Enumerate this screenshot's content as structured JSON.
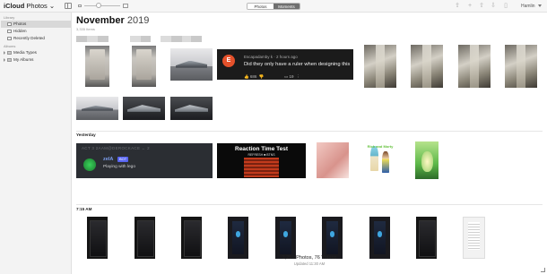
{
  "app": {
    "title_bold": "iCloud",
    "title_rest": " Photos",
    "title_caret": "⌄"
  },
  "toolbar": {
    "segment": [
      {
        "label": "Photos",
        "active": false
      },
      {
        "label": "Moments",
        "active": true
      }
    ],
    "user_name": "Hamlin",
    "zoom_level": 0.4
  },
  "sidebar": {
    "library_heading": "Library",
    "library_items": [
      {
        "label": "Photos",
        "active": true
      },
      {
        "label": "Hidden"
      },
      {
        "label": "Recently Deleted"
      }
    ],
    "albums_heading": "Albums",
    "album_items": [
      {
        "label": "Media Types"
      },
      {
        "label": "My Albums"
      }
    ]
  },
  "main": {
    "month": "November",
    "year": "2019",
    "subcount": "3,335 Items",
    "sections": [
      {
        "label": "Yesterday"
      },
      {
        "label": "7:15 AM"
      }
    ],
    "youtube_card": {
      "avatar_letter": "E",
      "author": "Escapadamby k · 2 hours ago",
      "comment": "Did they only have a ruler when designing this",
      "likes": "686",
      "replies": "19"
    },
    "discord_card": {
      "top_text": "ACT 3 2AAM@DEROCKACE ← 2",
      "name": "zelA",
      "bot_tag": "BOT",
      "status": "Playing with lego"
    },
    "reaction_card": {
      "title": "Reaction Time Test",
      "subtitle": "REFRESH ■ BTNS"
    },
    "rick_card": {
      "logo": "Rick and Morty"
    },
    "footer": {
      "count": "3,259 Photos, 76 Videos",
      "updated": "Updated 11:30 AM"
    }
  }
}
